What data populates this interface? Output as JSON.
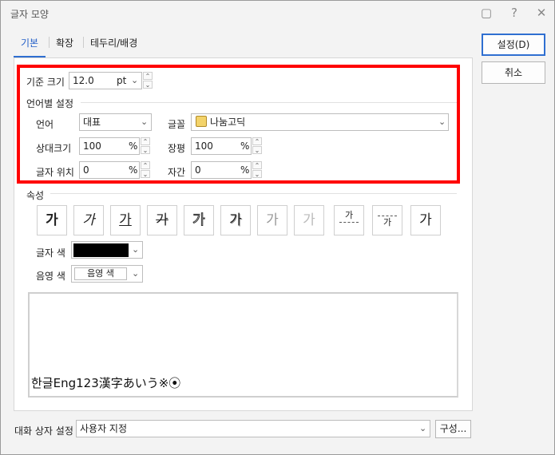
{
  "window": {
    "title": "글자 모양"
  },
  "titlebar_icons": [
    "comment-icon",
    "help-icon",
    "close-icon"
  ],
  "tabs": [
    {
      "label": "기본",
      "active": true
    },
    {
      "label": "확장",
      "active": false
    },
    {
      "label": "테두리/배경",
      "active": false
    }
  ],
  "base_size": {
    "label": "기준 크기",
    "value": "12.0",
    "unit": "pt"
  },
  "lang_section": {
    "title": "언어별 설정",
    "language": {
      "label": "언어",
      "value": "대표"
    },
    "font": {
      "label": "글꼴",
      "value": "나눔고딕"
    },
    "rel_size": {
      "label": "상대크기",
      "value": "100",
      "unit": "%"
    },
    "width": {
      "label": "장평",
      "value": "100",
      "unit": "%"
    },
    "position": {
      "label": "글자 위치",
      "value": "0",
      "unit": "%"
    },
    "spacing": {
      "label": "자간",
      "value": "0",
      "unit": "%"
    }
  },
  "attributes": {
    "title": "속성",
    "buttons": [
      "가",
      "가",
      "가",
      "가",
      "가",
      "가",
      "가",
      "가",
      "가",
      "가",
      "가"
    ],
    "text_color_label": "글자 색",
    "shade_color_label": "음영 색",
    "shade_color_value": "음영 색",
    "text_color": "#000000"
  },
  "preview": {
    "text": "한글Eng123漢字あいう※⦿"
  },
  "dialog_setting": {
    "label": "대화 상자 설정",
    "value": "사용자 지정",
    "configure_label": "구성..."
  },
  "buttons": {
    "ok": "설정(D)",
    "cancel": "취소"
  },
  "colors": {
    "accent": "#2f6fd1",
    "highlight": "#ff0000"
  }
}
